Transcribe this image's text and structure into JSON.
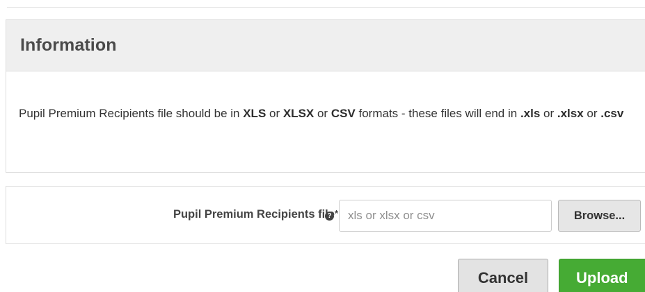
{
  "information": {
    "title": "Information",
    "text_1": "Pupil Premium Recipients file should be in ",
    "fmt_xls": "XLS",
    "or_1": " or ",
    "fmt_xlsx": "XLSX",
    "or_2": " or ",
    "fmt_csv": "CSV",
    "text_2": " formats - these files will end in ",
    "ext_xls": ".xls",
    "or_3": " or ",
    "ext_xlsx": ".xlsx",
    "or_4": " or ",
    "ext_csv": ".csv"
  },
  "upload_form": {
    "field_label": "Pupil Premium Recipients file",
    "required_marker": "*",
    "help_icon": "question-circle-icon",
    "help_glyph": "?",
    "file_placeholder": "xls or xlsx or csv",
    "browse_label": "Browse..."
  },
  "actions": {
    "cancel_label": "Cancel",
    "upload_label": "Upload"
  },
  "colors": {
    "upload_button": "#46ab34",
    "header_background": "#efefef"
  }
}
